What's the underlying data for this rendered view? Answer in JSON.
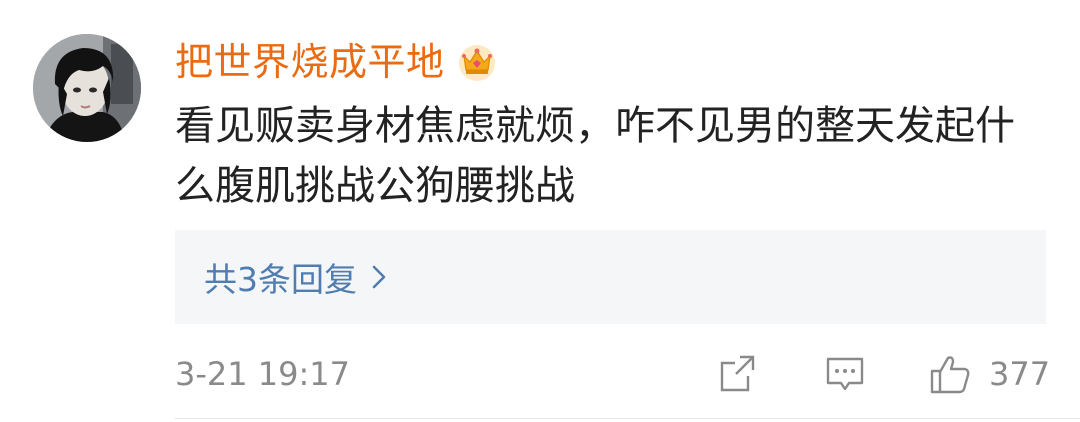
{
  "comment": {
    "username": "把世界烧成平地",
    "badge_icon": "crown-icon",
    "text": "看见贩卖身材焦虑就烦，咋不见男的整天发起什么腹肌挑战公狗腰挑战",
    "replies_label": "共3条回复",
    "timestamp": "3-21 19:17",
    "like_count": "377"
  },
  "colors": {
    "username": "#ea6b12",
    "link": "#507daf",
    "text": "#222222",
    "meta": "#8a8a8a",
    "reply_bg": "#f5f6f8"
  }
}
